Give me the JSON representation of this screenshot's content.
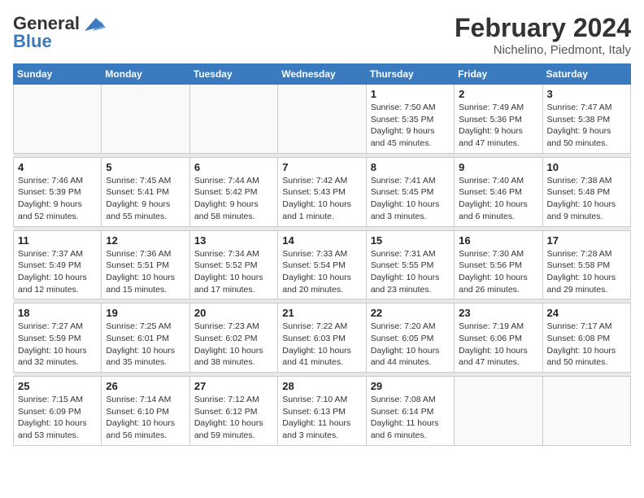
{
  "header": {
    "logo_line1": "General",
    "logo_line2": "Blue",
    "month": "February 2024",
    "location": "Nichelino, Piedmont, Italy"
  },
  "days_of_week": [
    "Sunday",
    "Monday",
    "Tuesday",
    "Wednesday",
    "Thursday",
    "Friday",
    "Saturday"
  ],
  "weeks": [
    [
      {
        "day": "",
        "info": ""
      },
      {
        "day": "",
        "info": ""
      },
      {
        "day": "",
        "info": ""
      },
      {
        "day": "",
        "info": ""
      },
      {
        "day": "1",
        "info": "Sunrise: 7:50 AM\nSunset: 5:35 PM\nDaylight: 9 hours and 45 minutes."
      },
      {
        "day": "2",
        "info": "Sunrise: 7:49 AM\nSunset: 5:36 PM\nDaylight: 9 hours and 47 minutes."
      },
      {
        "day": "3",
        "info": "Sunrise: 7:47 AM\nSunset: 5:38 PM\nDaylight: 9 hours and 50 minutes."
      }
    ],
    [
      {
        "day": "4",
        "info": "Sunrise: 7:46 AM\nSunset: 5:39 PM\nDaylight: 9 hours and 52 minutes."
      },
      {
        "day": "5",
        "info": "Sunrise: 7:45 AM\nSunset: 5:41 PM\nDaylight: 9 hours and 55 minutes."
      },
      {
        "day": "6",
        "info": "Sunrise: 7:44 AM\nSunset: 5:42 PM\nDaylight: 9 hours and 58 minutes."
      },
      {
        "day": "7",
        "info": "Sunrise: 7:42 AM\nSunset: 5:43 PM\nDaylight: 10 hours and 1 minute."
      },
      {
        "day": "8",
        "info": "Sunrise: 7:41 AM\nSunset: 5:45 PM\nDaylight: 10 hours and 3 minutes."
      },
      {
        "day": "9",
        "info": "Sunrise: 7:40 AM\nSunset: 5:46 PM\nDaylight: 10 hours and 6 minutes."
      },
      {
        "day": "10",
        "info": "Sunrise: 7:38 AM\nSunset: 5:48 PM\nDaylight: 10 hours and 9 minutes."
      }
    ],
    [
      {
        "day": "11",
        "info": "Sunrise: 7:37 AM\nSunset: 5:49 PM\nDaylight: 10 hours and 12 minutes."
      },
      {
        "day": "12",
        "info": "Sunrise: 7:36 AM\nSunset: 5:51 PM\nDaylight: 10 hours and 15 minutes."
      },
      {
        "day": "13",
        "info": "Sunrise: 7:34 AM\nSunset: 5:52 PM\nDaylight: 10 hours and 17 minutes."
      },
      {
        "day": "14",
        "info": "Sunrise: 7:33 AM\nSunset: 5:54 PM\nDaylight: 10 hours and 20 minutes."
      },
      {
        "day": "15",
        "info": "Sunrise: 7:31 AM\nSunset: 5:55 PM\nDaylight: 10 hours and 23 minutes."
      },
      {
        "day": "16",
        "info": "Sunrise: 7:30 AM\nSunset: 5:56 PM\nDaylight: 10 hours and 26 minutes."
      },
      {
        "day": "17",
        "info": "Sunrise: 7:28 AM\nSunset: 5:58 PM\nDaylight: 10 hours and 29 minutes."
      }
    ],
    [
      {
        "day": "18",
        "info": "Sunrise: 7:27 AM\nSunset: 5:59 PM\nDaylight: 10 hours and 32 minutes."
      },
      {
        "day": "19",
        "info": "Sunrise: 7:25 AM\nSunset: 6:01 PM\nDaylight: 10 hours and 35 minutes."
      },
      {
        "day": "20",
        "info": "Sunrise: 7:23 AM\nSunset: 6:02 PM\nDaylight: 10 hours and 38 minutes."
      },
      {
        "day": "21",
        "info": "Sunrise: 7:22 AM\nSunset: 6:03 PM\nDaylight: 10 hours and 41 minutes."
      },
      {
        "day": "22",
        "info": "Sunrise: 7:20 AM\nSunset: 6:05 PM\nDaylight: 10 hours and 44 minutes."
      },
      {
        "day": "23",
        "info": "Sunrise: 7:19 AM\nSunset: 6:06 PM\nDaylight: 10 hours and 47 minutes."
      },
      {
        "day": "24",
        "info": "Sunrise: 7:17 AM\nSunset: 6:08 PM\nDaylight: 10 hours and 50 minutes."
      }
    ],
    [
      {
        "day": "25",
        "info": "Sunrise: 7:15 AM\nSunset: 6:09 PM\nDaylight: 10 hours and 53 minutes."
      },
      {
        "day": "26",
        "info": "Sunrise: 7:14 AM\nSunset: 6:10 PM\nDaylight: 10 hours and 56 minutes."
      },
      {
        "day": "27",
        "info": "Sunrise: 7:12 AM\nSunset: 6:12 PM\nDaylight: 10 hours and 59 minutes."
      },
      {
        "day": "28",
        "info": "Sunrise: 7:10 AM\nSunset: 6:13 PM\nDaylight: 11 hours and 3 minutes."
      },
      {
        "day": "29",
        "info": "Sunrise: 7:08 AM\nSunset: 6:14 PM\nDaylight: 11 hours and 6 minutes."
      },
      {
        "day": "",
        "info": ""
      },
      {
        "day": "",
        "info": ""
      }
    ]
  ]
}
